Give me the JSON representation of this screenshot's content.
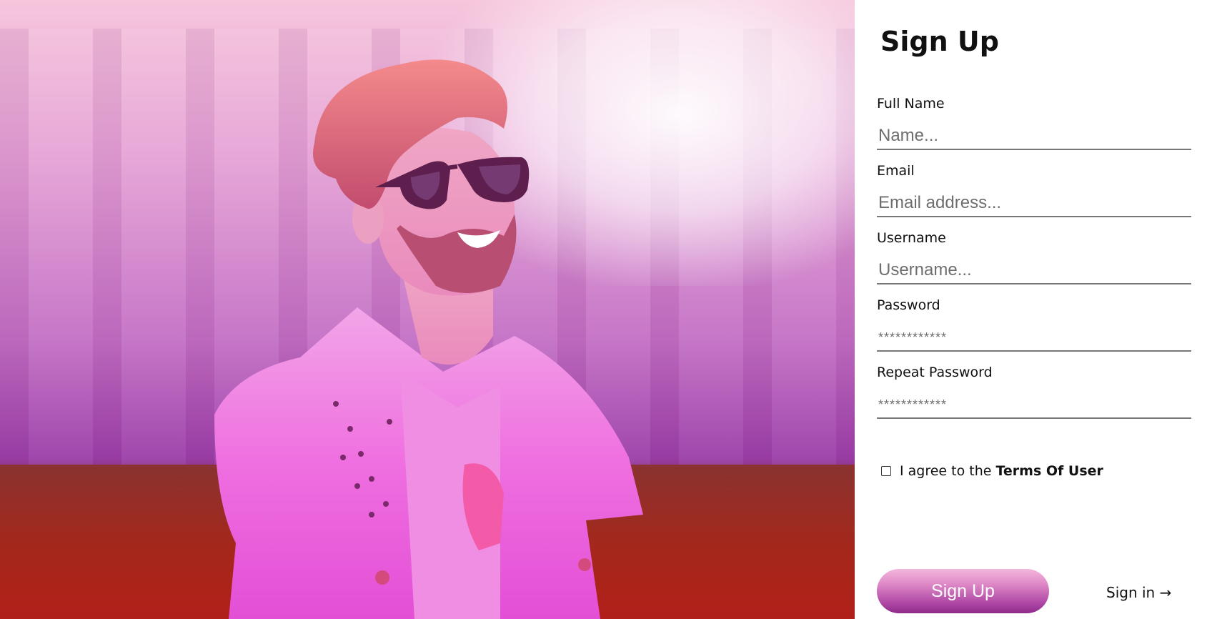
{
  "form": {
    "title": "Sign Up",
    "fields": [
      {
        "label": "Full Name",
        "placeholder": "Name..."
      },
      {
        "label": "Email",
        "placeholder": "Email address..."
      },
      {
        "label": "Username",
        "placeholder": "Username..."
      },
      {
        "label": "Password",
        "placeholder": "************"
      },
      {
        "label": "Repeat Password",
        "placeholder": "************"
      }
    ],
    "agree_prefix": "I agree to the",
    "agree_terms": "Terms Of User",
    "agree_checked": false,
    "submit_label": "Sign Up",
    "signin_label": "Sign in →"
  },
  "colors": {
    "button_top": "#f3b7dc",
    "button_bottom": "#8e2a8c",
    "photo_tint": "#d86fd0",
    "grass": "#a5271b"
  }
}
